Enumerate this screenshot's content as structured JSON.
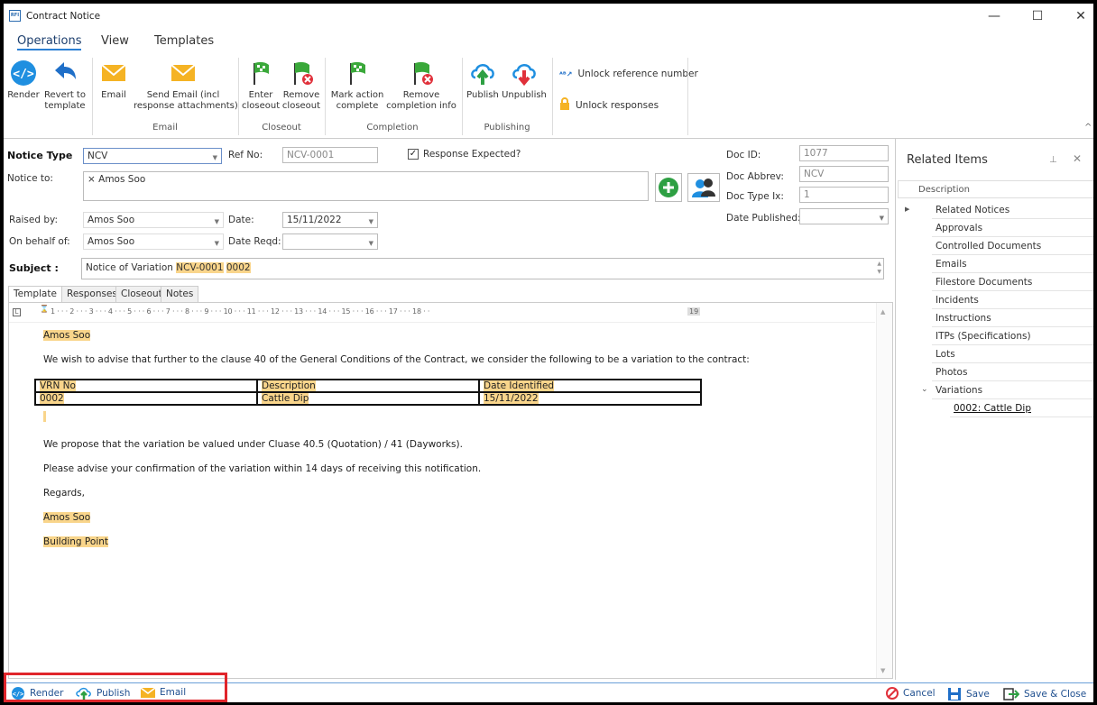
{
  "window": {
    "title": "Contract Notice",
    "app_icon_text": "RFI"
  },
  "menu_tabs": [
    "Operations",
    "View",
    "Templates"
  ],
  "ribbon": {
    "render": "Render",
    "revert": "Revert to\ntemplate",
    "email": "Email",
    "send_email": "Send Email (incl\nresponse attachments)",
    "enter_closeout": "Enter\ncloseout",
    "remove_closeout": "Remove\ncloseout",
    "mark_action_complete": "Mark action\ncomplete",
    "remove_completion": "Remove\ncompletion info",
    "publish": "Publish",
    "unpublish": "Unpublish",
    "unlock_reference": "Unlock reference number",
    "unlock_responses": "Unlock responses",
    "groups": {
      "email": "Email",
      "closeout": "Closeout",
      "completion": "Completion",
      "publishing": "Publishing"
    }
  },
  "form": {
    "notice_type_label": "Notice Type",
    "notice_type_value": "NCV",
    "ref_no_label": "Ref No:",
    "ref_no_value": "NCV-0001",
    "response_expected_label": "Response Expected?",
    "response_expected_checked": true,
    "notice_to_label": "Notice to:",
    "notice_to_value": "× Amos Soo",
    "raised_by_label": "Raised by:",
    "raised_by_value": "Amos Soo",
    "date_label": "Date:",
    "date_value": "15/11/2022",
    "on_behalf_label": "On behalf of:",
    "on_behalf_value": "Amos Soo",
    "date_reqd_label": "Date Reqd:",
    "date_reqd_value": "",
    "subject_label": "Subject",
    "subject_prefix": "Notice of Variation ",
    "subject_hl1": "NCV-0001",
    "subject_hl2": "0002",
    "doc_id_label": "Doc ID:",
    "doc_id_value": "1077",
    "doc_abbrev_label": "Doc Abbrev:",
    "doc_abbrev_value": "NCV",
    "doc_type_ix_label": "Doc Type Ix:",
    "doc_type_ix_value": "1",
    "date_published_label": "Date Published:",
    "date_published_value": ""
  },
  "doc_tabs": [
    "Template",
    "Responses",
    "Closeout",
    "Notes"
  ],
  "ruler_text": "1 · · · 2 · · · 3 · · · 4 · · · 5 · · · 6 · · · 7 · · · 8 · · · 9 · · · 10 · · · 11 · · · 12 · · · 13 · · · 14 · · · 15 · · · 16 · · · 17 · · · 18 · ·",
  "ruler_end": "19",
  "document": {
    "addressee": "Amos Soo",
    "intro": "We wish to advise that further to the clause 40 of the General Conditions of the Contract, we consider the following to be a variation to the contract:",
    "table_headers": [
      "VRN No",
      "Description",
      "Date Identified"
    ],
    "table_row": [
      "0002",
      "Cattle Dip",
      "15/11/2022"
    ],
    "para1": "We propose that the variation be valued under Cluase 40.5 (Quotation) / 41 (Dayworks).",
    "para2": "Please advise your confirmation of the variation within 14 days of receiving this notification.",
    "regards": "Regards,",
    "signer": "Amos Soo",
    "company": "Building Point"
  },
  "related": {
    "title": "Related Items",
    "column": "Description",
    "items": [
      "Related Notices",
      "Approvals",
      "Controlled Documents",
      "Emails",
      "Filestore Documents",
      "Incidents",
      "Instructions",
      "ITPs (Specifications)",
      "Lots",
      "Photos",
      "Variations"
    ],
    "child": "0002: Cattle Dip"
  },
  "bottom": {
    "render": "Render",
    "publish": "Publish",
    "email": "Email",
    "cancel": "Cancel",
    "save": "Save",
    "save_close": "Save & Close"
  },
  "colors": {
    "accent": "#2a7fd4",
    "highlight": "#f9d58b",
    "annotation": "#e0252b"
  }
}
